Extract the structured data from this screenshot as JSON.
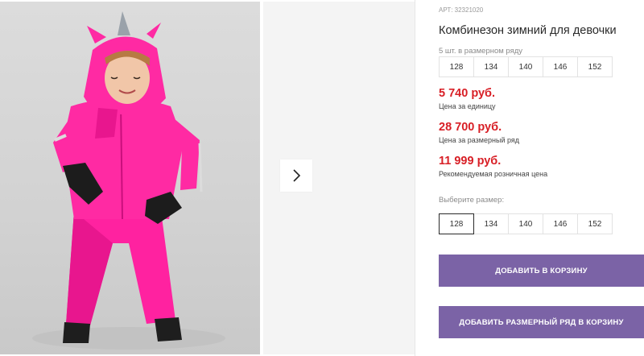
{
  "product": {
    "article": "АРТ: 32321020",
    "title": "Комбинезон зимний для девочки"
  },
  "pack": {
    "note": "5 шт. в размерном ряду",
    "sizes": [
      "128",
      "134",
      "140",
      "146",
      "152"
    ]
  },
  "prices": [
    {
      "value": "5 740 руб.",
      "label": "Цена за единицу"
    },
    {
      "value": "28 700 руб.",
      "label": "Цена за размерный ряд"
    },
    {
      "value": "11 999 руб.",
      "label": "Рекомендуемая розничная цена"
    }
  ],
  "size_select": {
    "label": "Выберите размер:",
    "options": [
      "128",
      "134",
      "140",
      "146",
      "152"
    ],
    "selected": "128"
  },
  "buttons": {
    "add_to_cart": "ДОБАВИТЬ В КОРЗИНУ",
    "add_pack_to_cart": "ДОБАВИТЬ РАЗМЕРНЫЙ РЯД В КОРЗИНУ"
  },
  "gallery": {
    "next_icon": "chevron-right-icon"
  },
  "colors": {
    "accent_button": "#7b63a6",
    "price": "#d81f26",
    "product_pink": "#ff2aa3"
  }
}
